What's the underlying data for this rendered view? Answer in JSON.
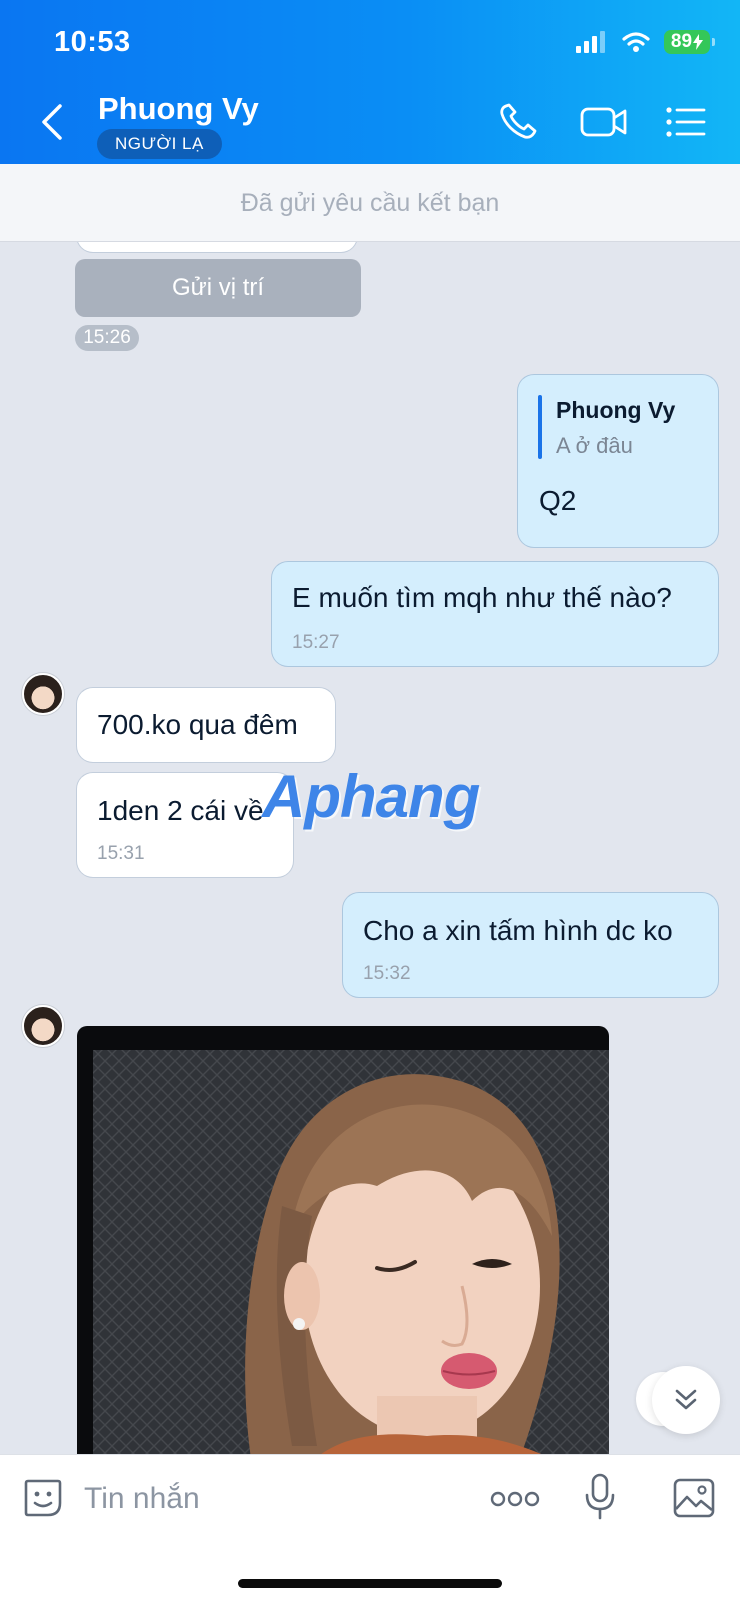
{
  "status": {
    "time": "10:53",
    "battery": "89"
  },
  "header": {
    "contact_name": "Phuong Vy",
    "contact_badge": "NGƯỜI LẠ"
  },
  "friend_request": {
    "text": "Đã gửi yêu cầu kết bạn"
  },
  "messages": {
    "location_button": "Gửi vị trí",
    "location_time": "15:26",
    "reply_quote_author": "Phuong Vy",
    "reply_quote_text": "A ở đâu",
    "reply_text": "Q2",
    "out_question": "E muốn tìm mqh như thế nào?",
    "out_question_time": "15:27",
    "in_price": "700.ko qua đêm",
    "in_detail": "1den 2 cái về",
    "in_detail_time": "15:31",
    "out_request": "Cho a xin tấm hình dc ko",
    "out_request_time": "15:32"
  },
  "watermark": "Aphang",
  "composer": {
    "placeholder": "Tin nhắn"
  },
  "colors": {
    "header_start": "#0a76f2",
    "header_end": "#12b6f6",
    "out_bubble": "#d4eefd",
    "chat_bg": "#e2e6ee"
  }
}
